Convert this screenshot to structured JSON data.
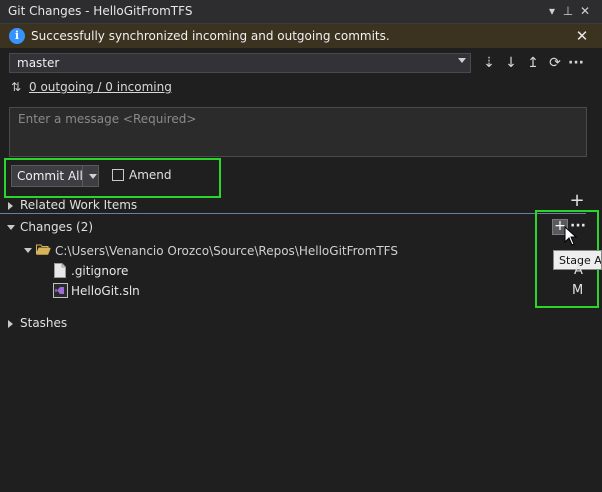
{
  "window": {
    "title": "Git Changes - HelloGitFromTFS"
  },
  "infobar": {
    "message": "Successfully synchronized incoming and outgoing commits."
  },
  "branch": {
    "selected": "master"
  },
  "sync": {
    "link_text": "0 outgoing / 0 incoming"
  },
  "message_box": {
    "placeholder": "Enter a message <Required>"
  },
  "commit": {
    "button_label": "Commit All",
    "amend_label": "Amend",
    "amend_checked": false
  },
  "sections": {
    "related_work_items": "Related Work Items",
    "changes": "Changes (2)",
    "stashes": "Stashes"
  },
  "changes": {
    "folder_path": "C:\\Users\\Venancio Orozco\\Source\\Repos\\HelloGitFromTFS",
    "files": [
      {
        "name": ".gitignore",
        "status": "A"
      },
      {
        "name": "HelloGit.sln",
        "status": "M"
      }
    ]
  },
  "tooltip": {
    "text": "Stage All"
  },
  "colors": {
    "highlight": "#2bd62b",
    "info_blue": "#3794ff",
    "background": "#1f1f1f"
  }
}
